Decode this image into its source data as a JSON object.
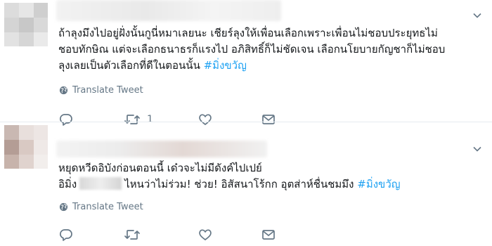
{
  "tweets": [
    {
      "lines": [
        "ถ้าลุงมึงไปอยู่ฝั่งนั้นกูนี่หมาเลยนะ เชียร์ลุงให้เพื่อนเลือกเพราะเพื่อนไม่ชอบประยุทธไม่",
        "ชอบทักษิณ แต่จะเลือกธนาธรก็แรงไป อภิสิทธิ์ก็ไม่ชัดเจน เลือกนโยบายกัญชาก็ไม่ชอบ",
        "ลุงเลยเป็นตัวเลือกที่ดีในตอนนั้น"
      ],
      "hashtag": "#มิ่งขวัญ",
      "translate_label": "Translate Tweet",
      "retweet_count": "1"
    },
    {
      "lines": [
        "หยุดหวีดอิบังก่อนตอนนี้ เด๋วจะไม่มีดังค์ไปเปย์"
      ],
      "line2_prefix": "อิมิ่ง",
      "line2_suffix": "ไหนว่าไม่ร่วม! ช่วย! อิสัสนาโร้กก อุตส่าห์ชื่นชมมึง",
      "hashtag": "#มิ่งขวัญ",
      "translate_label": "Translate Tweet",
      "retweet_count": ""
    }
  ],
  "colors": {
    "text": "#14171a",
    "secondary": "#657786",
    "hashtag": "#1da1f2",
    "divider": "#e6ecf0"
  },
  "icons": [
    "reply-icon",
    "retweet-icon",
    "like-icon",
    "dm-icon",
    "globe-icon",
    "chevron-down-icon"
  ]
}
